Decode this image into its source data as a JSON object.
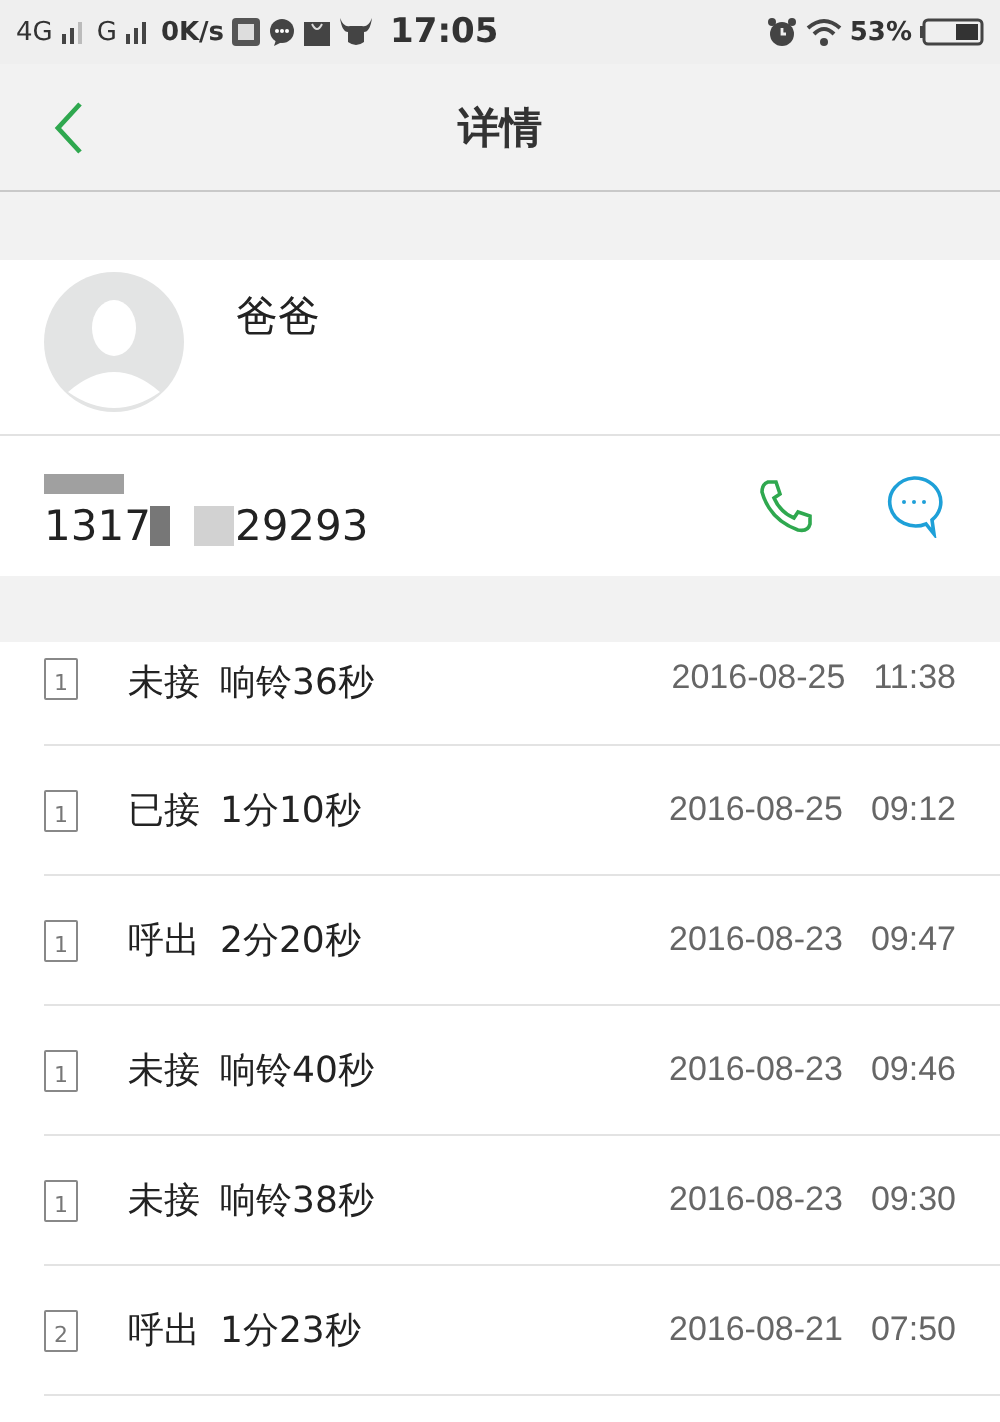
{
  "status_bar": {
    "network_1": "4G",
    "network_2": "G",
    "speed": "0K/s",
    "time": "17:05",
    "battery": "53%"
  },
  "header": {
    "title": "详情"
  },
  "contact": {
    "name": "爸爸",
    "number_parts": [
      "1317",
      "29293"
    ]
  },
  "calls": [
    {
      "sim": "1",
      "type": "未接",
      "detail": "响铃36秒",
      "date": "2016-08-25",
      "time": "11:38"
    },
    {
      "sim": "1",
      "type": "已接",
      "detail": "1分10秒",
      "date": "2016-08-25",
      "time": "09:12"
    },
    {
      "sim": "1",
      "type": "呼出",
      "detail": "2分20秒",
      "date": "2016-08-23",
      "time": "09:47"
    },
    {
      "sim": "1",
      "type": "未接",
      "detail": "响铃40秒",
      "date": "2016-08-23",
      "time": "09:46"
    },
    {
      "sim": "1",
      "type": "未接",
      "detail": "响铃38秒",
      "date": "2016-08-23",
      "time": "09:30"
    },
    {
      "sim": "2",
      "type": "呼出",
      "detail": "1分23秒",
      "date": "2016-08-21",
      "time": "07:50"
    }
  ]
}
